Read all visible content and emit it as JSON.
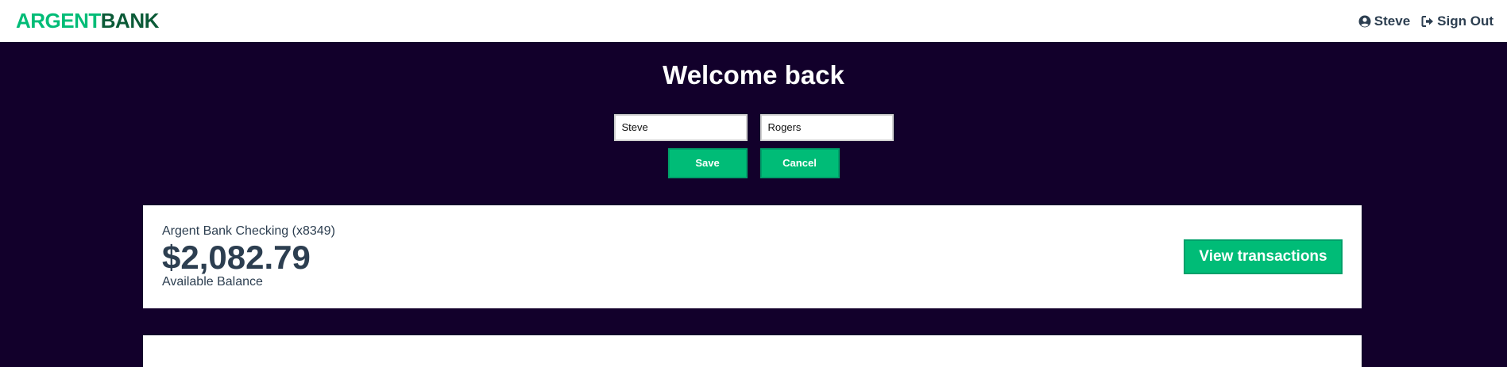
{
  "header": {
    "logo_part1": "ARGENT",
    "logo_part2": "BANK",
    "user_label": "Steve",
    "signout_label": "Sign Out"
  },
  "hero": {
    "title": "Welcome back",
    "first_name_value": "Steve",
    "last_name_value": "Rogers",
    "save_label": "Save",
    "cancel_label": "Cancel"
  },
  "accounts": [
    {
      "title": "Argent Bank Checking (x8349)",
      "amount": "$2,082.79",
      "description": "Available Balance",
      "button_label": "View transactions"
    }
  ],
  "colors": {
    "background": "#12002b",
    "accent": "#00bc77",
    "logo_dark": "#0b5a37",
    "text": "#2c3e50"
  },
  "icons": {
    "user": "user-circle-icon",
    "signout": "sign-out-icon"
  }
}
